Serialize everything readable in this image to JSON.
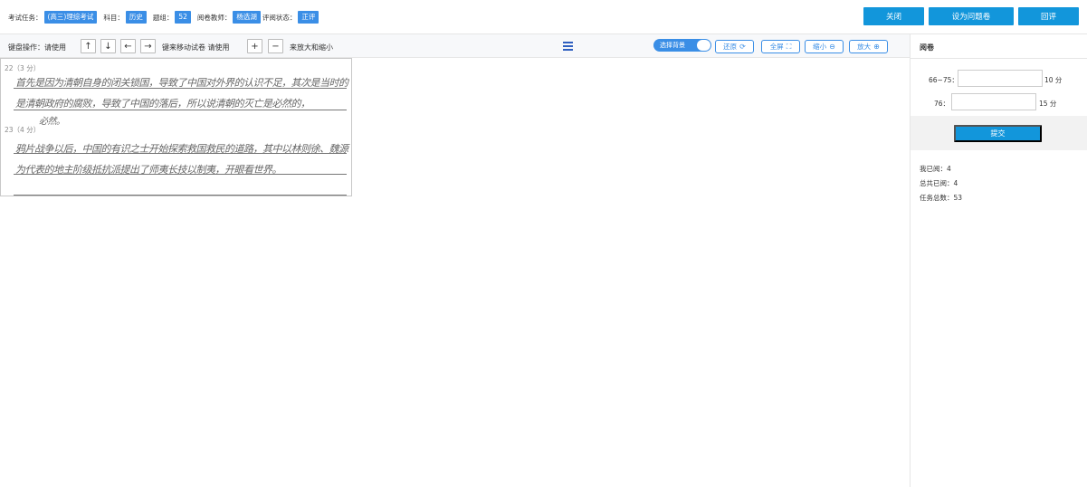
{
  "header": {
    "task_label": "考试任务：",
    "task_value": "(高三)理综考试",
    "subject_label": "科目：",
    "subject_value": "历史",
    "question_group_label": "题组：",
    "question_group_value": "52",
    "teacher_label": "阅卷教师：",
    "teacher_value": "杨选湖",
    "status_label": "评阅状态：",
    "status_value": "正评",
    "close_button": "关闭",
    "set_problem_button": "设为问题卷",
    "review_button": "回评"
  },
  "toolbar": {
    "keyboard_text": "键盘操作：请使用",
    "move_text": "键来移动试卷  请使用",
    "zoom_text": "来放大和缩小",
    "up_key": "↑",
    "down_key": "↓",
    "left_key": "←",
    "right_key": "→",
    "plus_key": "+",
    "minus_key": "−",
    "toggle_label": "选择背景",
    "restore_label": "还原",
    "fullscreen_label": "全屏",
    "zoom_out_label": "缩小",
    "zoom_in_label": "放大"
  },
  "paper": {
    "q22": "22（3 分）",
    "q23": "23（4 分）",
    "q22_line1": "首先是因为清朝自身的闭关锁国，导致了中国对外界的认识不足，其次是当时的",
    "q22_line2": "是清朝政府的腐败，导致了中国的落后，所以说清朝的灭亡是必然的，",
    "q22_line3": "必然。",
    "q23_line1": "鸦片战争以后，中国的有识之士开始探索救国救民的道路，其中以林则徐、魏源",
    "q23_line2": "为代表的地主阶级抵抗派提出了师夷长技以制夷，开眼看世界。"
  },
  "right_panel": {
    "title": "阅卷",
    "score_rows": [
      {
        "label": "66~75：",
        "unit": "10 分",
        "value": ""
      },
      {
        "label": "76：",
        "unit": "15 分",
        "value": ""
      }
    ],
    "submit_button": "提交",
    "stats": [
      "我已阅：4",
      "总共已阅：4",
      "任务总数：53"
    ]
  },
  "colors": {
    "accent": "#1296db",
    "tag": "#3a8ee6"
  },
  "icons": {
    "menu": "hamburger-menu-icon",
    "restore": "refresh-icon",
    "fullscreen": "fullscreen-icon",
    "zoom_out": "zoom-out-icon",
    "zoom_in": "zoom-in-icon"
  }
}
